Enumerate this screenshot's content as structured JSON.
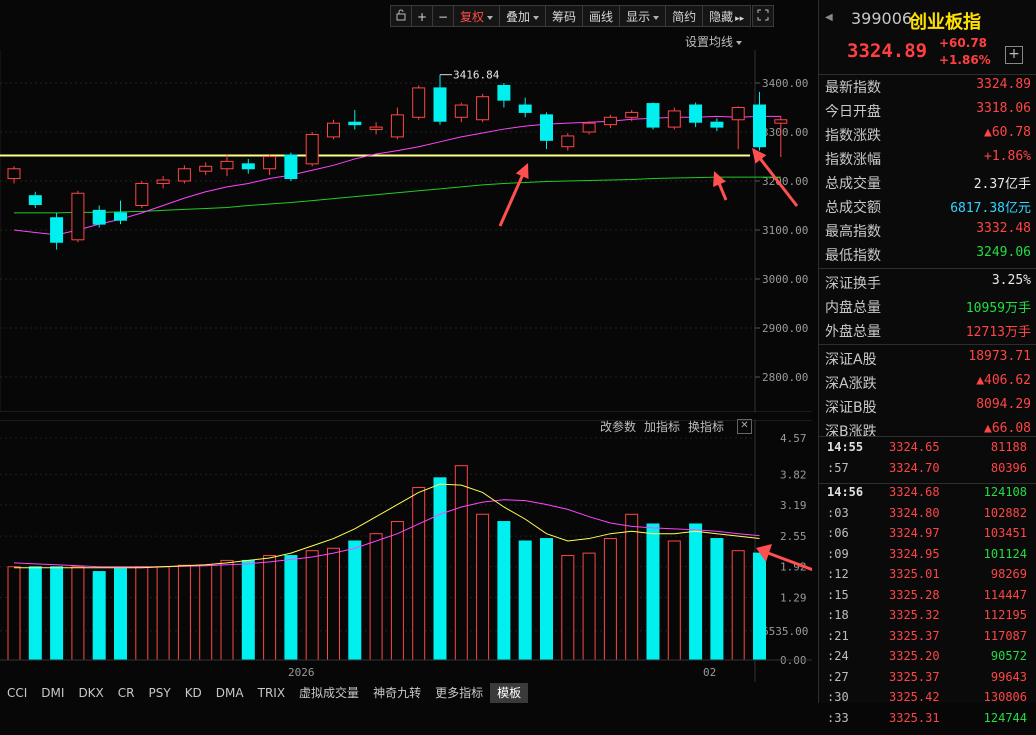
{
  "toolbar": {
    "items": [
      "复权",
      "叠加",
      "筹码",
      "画线",
      "显示",
      "简约",
      "隐藏"
    ],
    "lock_icon": "lock-icon",
    "plus": "+",
    "minus": "−"
  },
  "settings_ma": "设置均线",
  "price_axis": [
    "3400.00",
    "3300.00",
    "3200.00",
    "3100.00",
    "3000.00",
    "2900.00",
    "2800.00"
  ],
  "peak_label": "3416.84",
  "volume_panel": {
    "links": [
      "改参数",
      "加指标",
      "换指标"
    ],
    "axis": [
      "4.57",
      "3.82",
      "3.19",
      "2.55",
      "1.92",
      "1.29",
      "6535.00",
      "0.00"
    ],
    "x_labels": [
      "2026",
      "02"
    ]
  },
  "tabs": [
    "CCI",
    "DMI",
    "DKX",
    "CR",
    "PSY",
    "KD",
    "DMA",
    "TRIX",
    "虚拟成交量",
    "神奇九转",
    "更多指标",
    "模板"
  ],
  "quote": {
    "code": "399006",
    "name": "创业板指",
    "price": "3324.89",
    "change": "+60.78",
    "change_pct": "+1.86%",
    "rows": [
      {
        "k": "最新指数",
        "v": "3324.89",
        "c": "red"
      },
      {
        "k": "今日开盘",
        "v": "3318.06",
        "c": "red"
      },
      {
        "k": "指数涨跌",
        "v": "▲60.78",
        "c": "red"
      },
      {
        "k": "指数涨幅",
        "v": "+1.86%",
        "c": "red"
      },
      {
        "k": "总成交量",
        "v": "2.37亿手",
        "c": "white"
      },
      {
        "k": "总成交额",
        "v": "6817.38亿元",
        "c": "cyan"
      },
      {
        "k": "最高指数",
        "v": "3332.48",
        "c": "red"
      },
      {
        "k": "最低指数",
        "v": "3249.06",
        "c": "green"
      },
      {
        "k": "深证换手",
        "v": "3.25%",
        "c": "white"
      },
      {
        "k": "内盘总量",
        "v": "10959万手",
        "c": "green"
      },
      {
        "k": "外盘总量",
        "v": "12713万手",
        "c": "red"
      },
      {
        "k": "深证A股",
        "v": "18973.71",
        "c": "red"
      },
      {
        "k": "深A涨跌",
        "v": "▲406.62",
        "c": "red"
      },
      {
        "k": "深证B股",
        "v": "8094.29",
        "c": "red"
      },
      {
        "k": "深B涨跌",
        "v": "▲66.08",
        "c": "red"
      }
    ],
    "ticks": [
      {
        "t": "14:55",
        "p": "3324.65",
        "q": "81188",
        "c": "red"
      },
      {
        "t": ":57",
        "p": "3324.70",
        "q": "80396",
        "c": "red"
      },
      {
        "t": "14:56",
        "p": "3324.68",
        "q": "124108",
        "c": "green"
      },
      {
        "t": ":03",
        "p": "3324.80",
        "q": "102882",
        "c": "red"
      },
      {
        "t": ":06",
        "p": "3324.97",
        "q": "103451",
        "c": "red"
      },
      {
        "t": ":09",
        "p": "3324.95",
        "q": "101124",
        "c": "green"
      },
      {
        "t": ":12",
        "p": "3325.01",
        "q": "98269",
        "c": "red"
      },
      {
        "t": ":15",
        "p": "3325.28",
        "q": "114447",
        "c": "red"
      },
      {
        "t": ":18",
        "p": "3325.32",
        "q": "112195",
        "c": "red"
      },
      {
        "t": ":21",
        "p": "3325.37",
        "q": "117087",
        "c": "red"
      },
      {
        "t": ":24",
        "p": "3325.20",
        "q": "90572",
        "c": "green"
      },
      {
        "t": ":27",
        "p": "3325.37",
        "q": "99643",
        "c": "red"
      },
      {
        "t": ":30",
        "p": "3325.42",
        "q": "130806",
        "c": "red"
      },
      {
        "t": ":33",
        "p": "3325.31",
        "q": "124744",
        "c": "green"
      }
    ]
  },
  "colors": {
    "up": "#ff4545",
    "down": "#00f0f0",
    "ma5": "#ffff55",
    "ma10": "#ff44ff",
    "ma20": "#22cc22",
    "support": "#ffff88",
    "arrow": "#ff5050"
  },
  "candles": [
    {
      "o": 3205,
      "c": 3225,
      "h": 3230,
      "l": 3195
    },
    {
      "o": 3170,
      "c": 3152,
      "h": 3178,
      "l": 3145
    },
    {
      "o": 3125,
      "c": 3075,
      "h": 3135,
      "l": 3060
    },
    {
      "o": 3080,
      "c": 3175,
      "h": 3180,
      "l": 3075
    },
    {
      "o": 3140,
      "c": 3112,
      "h": 3150,
      "l": 3105
    },
    {
      "o": 3135,
      "c": 3120,
      "h": 3160,
      "l": 3112
    },
    {
      "o": 3150,
      "c": 3195,
      "h": 3200,
      "l": 3145
    },
    {
      "o": 3195,
      "c": 3202,
      "h": 3210,
      "l": 3185
    },
    {
      "o": 3200,
      "c": 3225,
      "h": 3232,
      "l": 3195
    },
    {
      "o": 3220,
      "c": 3230,
      "h": 3238,
      "l": 3212
    },
    {
      "o": 3225,
      "c": 3240,
      "h": 3255,
      "l": 3210
    },
    {
      "o": 3235,
      "c": 3225,
      "h": 3245,
      "l": 3215
    },
    {
      "o": 3225,
      "c": 3250,
      "h": 3255,
      "l": 3212
    },
    {
      "o": 3253,
      "c": 3205,
      "h": 3258,
      "l": 3200
    },
    {
      "o": 3235,
      "c": 3295,
      "h": 3300,
      "l": 3230
    },
    {
      "o": 3290,
      "c": 3318,
      "h": 3325,
      "l": 3285
    },
    {
      "o": 3320,
      "c": 3315,
      "h": 3345,
      "l": 3305
    },
    {
      "o": 3305,
      "c": 3310,
      "h": 3320,
      "l": 3295
    },
    {
      "o": 3290,
      "c": 3335,
      "h": 3350,
      "l": 3285
    },
    {
      "o": 3330,
      "c": 3390,
      "h": 3395,
      "l": 3325
    },
    {
      "o": 3390,
      "c": 3322,
      "h": 3417,
      "l": 3315
    },
    {
      "o": 3330,
      "c": 3355,
      "h": 3360,
      "l": 3320
    },
    {
      "o": 3325,
      "c": 3372,
      "h": 3378,
      "l": 3320
    },
    {
      "o": 3395,
      "c": 3365,
      "h": 3400,
      "l": 3350
    },
    {
      "o": 3355,
      "c": 3340,
      "h": 3370,
      "l": 3330
    },
    {
      "o": 3335,
      "c": 3283,
      "h": 3340,
      "l": 3265
    },
    {
      "o": 3270,
      "c": 3292,
      "h": 3298,
      "l": 3262
    },
    {
      "o": 3300,
      "c": 3318,
      "h": 3322,
      "l": 3295
    },
    {
      "o": 3315,
      "c": 3330,
      "h": 3335,
      "l": 3308
    },
    {
      "o": 3330,
      "c": 3340,
      "h": 3345,
      "l": 3322
    },
    {
      "o": 3358,
      "c": 3310,
      "h": 3360,
      "l": 3305
    },
    {
      "o": 3310,
      "c": 3343,
      "h": 3350,
      "l": 3305
    },
    {
      "o": 3355,
      "c": 3320,
      "h": 3360,
      "l": 3310
    },
    {
      "o": 3320,
      "c": 3310,
      "h": 3328,
      "l": 3302
    },
    {
      "o": 3325,
      "c": 3350,
      "h": 3352,
      "l": 3265
    },
    {
      "o": 3355,
      "c": 3270,
      "h": 3382,
      "l": 3262
    },
    {
      "o": 3318,
      "c": 3325,
      "h": 3332,
      "l": 3249
    }
  ],
  "volumes": [
    1.92,
    1.92,
    1.92,
    1.92,
    1.82,
    1.88,
    1.92,
    1.92,
    1.95,
    1.95,
    2.05,
    2.05,
    2.15,
    2.15,
    2.25,
    2.3,
    2.45,
    2.6,
    2.85,
    3.55,
    3.75,
    4.0,
    3.0,
    2.85,
    2.45,
    2.5,
    2.15,
    2.2,
    2.5,
    3.0,
    2.8,
    2.45,
    2.8,
    2.5,
    2.25,
    2.2
  ],
  "ma5_vol": [
    1.9,
    1.9,
    1.9,
    1.9,
    1.9,
    1.9,
    1.9,
    1.92,
    1.94,
    1.96,
    2.0,
    2.05,
    2.1,
    2.2,
    2.35,
    2.5,
    2.7,
    2.95,
    3.2,
    3.45,
    3.62,
    3.6,
    3.45,
    3.15,
    2.9,
    2.6,
    2.45,
    2.5,
    2.6,
    2.65,
    2.6,
    2.6,
    2.65,
    2.6,
    2.55,
    2.5
  ],
  "ma10_vol": [
    2.0,
    1.98,
    1.96,
    1.94,
    1.92,
    1.92,
    1.92,
    1.92,
    1.93,
    1.94,
    1.96,
    1.98,
    2.02,
    2.07,
    2.12,
    2.2,
    2.3,
    2.45,
    2.6,
    2.8,
    3.0,
    3.15,
    3.25,
    3.3,
    3.28,
    3.2,
    3.1,
    2.95,
    2.82,
    2.75,
    2.72,
    2.7,
    2.68,
    2.65,
    2.6,
    2.56
  ],
  "ma10_price": [
    3100,
    3095,
    3090,
    3100,
    3112,
    3122,
    3135,
    3150,
    3165,
    3178,
    3188,
    3195,
    3205,
    3212,
    3222,
    3232,
    3245,
    3255,
    3262,
    3270,
    3280,
    3290,
    3298,
    3306,
    3312,
    3316,
    3318,
    3320,
    3322,
    3326,
    3328,
    3330,
    3330,
    3332,
    3330,
    3332,
    3332
  ],
  "ma20_price": [
    3135,
    3135,
    3135,
    3136,
    3136,
    3137,
    3138,
    3140,
    3142,
    3144,
    3146,
    3150,
    3153,
    3156,
    3160,
    3164,
    3168,
    3172,
    3176,
    3180,
    3184,
    3188,
    3192,
    3195,
    3197,
    3199,
    3200,
    3201,
    3202,
    3203,
    3205,
    3206,
    3207,
    3208,
    3208,
    3208,
    3208
  ],
  "support_level": 3252
}
